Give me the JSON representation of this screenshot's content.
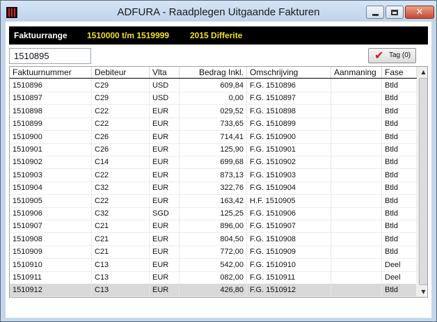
{
  "window": {
    "title": "ADFURA - Raadplegen Uitgaande Fakturen",
    "close_glyph": "✕"
  },
  "infobar": {
    "label": "Faktuurrange",
    "range": "1510000 t/m 1519999",
    "period": "2015 Differite"
  },
  "search": {
    "value": "1510895"
  },
  "tag_button": {
    "check_glyph": "✔",
    "label": "Tag (0)"
  },
  "table": {
    "columns": [
      "Faktuurnummer",
      "Debiteur",
      "Vlta",
      "Bedrag Inkl.",
      "Omschrijving",
      "Aanmaning",
      "Fase"
    ],
    "rows": [
      {
        "nr": "1510896",
        "deb": "C29",
        "vlta": "USD",
        "bedrag": "609,84",
        "omschr": "F.G. 1510896",
        "aanm": "",
        "fase": "Btld"
      },
      {
        "nr": "1510897",
        "deb": "C29",
        "vlta": "USD",
        "bedrag": "0,00",
        "omschr": "F.G. 1510897",
        "aanm": "",
        "fase": "Btld"
      },
      {
        "nr": "1510898",
        "deb": "C22",
        "vlta": "EUR",
        "bedrag": "029,52",
        "omschr": "F.G. 1510898",
        "aanm": "",
        "fase": "Btld"
      },
      {
        "nr": "1510899",
        "deb": "C22",
        "vlta": "EUR",
        "bedrag": "733,65",
        "omschr": "F.G. 1510899",
        "aanm": "",
        "fase": "Btld"
      },
      {
        "nr": "1510900",
        "deb": "C26",
        "vlta": "EUR",
        "bedrag": "714,41",
        "omschr": "F.G. 1510900",
        "aanm": "",
        "fase": "Btld"
      },
      {
        "nr": "1510901",
        "deb": "C26",
        "vlta": "EUR",
        "bedrag": "125,90",
        "omschr": "F.G. 1510901",
        "aanm": "",
        "fase": "Btld"
      },
      {
        "nr": "1510902",
        "deb": "C14",
        "vlta": "EUR",
        "bedrag": "699,68",
        "omschr": "F.G. 1510902",
        "aanm": "",
        "fase": "Btld"
      },
      {
        "nr": "1510903",
        "deb": "C22",
        "vlta": "EUR",
        "bedrag": "873,13",
        "omschr": "F.G. 1510903",
        "aanm": "",
        "fase": "Btld"
      },
      {
        "nr": "1510904",
        "deb": "C32",
        "vlta": "EUR",
        "bedrag": "322,76",
        "omschr": "F.G. 1510904",
        "aanm": "",
        "fase": "Btld"
      },
      {
        "nr": "1510905",
        "deb": "C22",
        "vlta": "EUR",
        "bedrag": "163,42",
        "omschr": "H.F. 1510905",
        "aanm": "",
        "fase": "Btld"
      },
      {
        "nr": "1510906",
        "deb": "C32",
        "vlta": "SGD",
        "bedrag": "125,25",
        "omschr": "F.G. 1510906",
        "aanm": "",
        "fase": "Btld"
      },
      {
        "nr": "1510907",
        "deb": "C21",
        "vlta": "EUR",
        "bedrag": "896,00",
        "omschr": "F.G. 1510907",
        "aanm": "",
        "fase": "Btld"
      },
      {
        "nr": "1510908",
        "deb": "C21",
        "vlta": "EUR",
        "bedrag": "804,50",
        "omschr": "F.G. 1510908",
        "aanm": "",
        "fase": "Btld"
      },
      {
        "nr": "1510909",
        "deb": "C21",
        "vlta": "EUR",
        "bedrag": "772,00",
        "omschr": "F.G. 1510909",
        "aanm": "",
        "fase": "Btld"
      },
      {
        "nr": "1510910",
        "deb": "C13",
        "vlta": "EUR",
        "bedrag": "542,00",
        "omschr": "F.G. 1510910",
        "aanm": "",
        "fase": "Deel"
      },
      {
        "nr": "1510911",
        "deb": "C13",
        "vlta": "EUR",
        "bedrag": "082,00",
        "omschr": "F.G. 1510911",
        "aanm": "",
        "fase": "Deel"
      },
      {
        "nr": "1510912",
        "deb": "C13",
        "vlta": "EUR",
        "bedrag": "426,80",
        "omschr": "F.G. 1510912",
        "aanm": "",
        "fase": "Btld",
        "selected": true
      }
    ]
  },
  "scrollbar": {
    "up_glyph": "▲",
    "down_glyph": "▼"
  }
}
